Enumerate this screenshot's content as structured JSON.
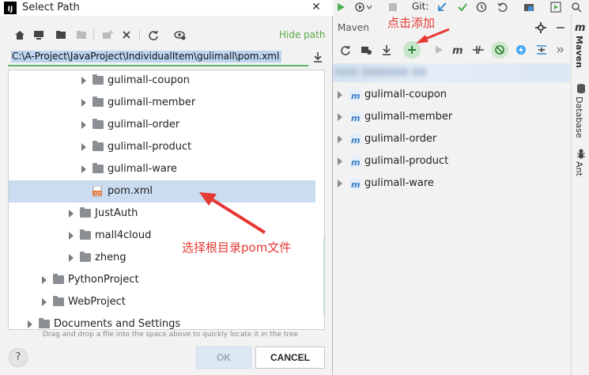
{
  "dialog": {
    "logo_text": "IJ",
    "title": "Select Path",
    "close": "✕",
    "hide_path": "Hide path",
    "path_value": "C:\\A-Project\\JavaProject\\IndividualItem\\gulimall\\pom.xml",
    "tree": [
      {
        "label": "gulimall-coupon",
        "depth": 4,
        "kind": "folder",
        "expandable": true,
        "selected": false
      },
      {
        "label": "gulimall-member",
        "depth": 4,
        "kind": "folder",
        "expandable": true,
        "selected": false
      },
      {
        "label": "gulimall-order",
        "depth": 4,
        "kind": "folder",
        "expandable": true,
        "selected": false
      },
      {
        "label": "gulimall-product",
        "depth": 4,
        "kind": "folder",
        "expandable": true,
        "selected": false
      },
      {
        "label": "gulimall-ware",
        "depth": 4,
        "kind": "folder",
        "expandable": true,
        "selected": false
      },
      {
        "label": "pom.xml",
        "depth": 4,
        "kind": "file",
        "expandable": false,
        "selected": true
      },
      {
        "label": "JustAuth",
        "depth": 3,
        "kind": "folder",
        "expandable": true,
        "selected": false
      },
      {
        "label": "mall4cloud",
        "depth": 3,
        "kind": "folder",
        "expandable": true,
        "selected": false
      },
      {
        "label": "zheng",
        "depth": 3,
        "kind": "folder",
        "expandable": true,
        "selected": false
      },
      {
        "label": "PythonProject",
        "depth": 2,
        "kind": "folder",
        "expandable": true,
        "selected": false
      },
      {
        "label": "WebProject",
        "depth": 2,
        "kind": "folder",
        "expandable": true,
        "selected": false
      },
      {
        "label": "Documents and Settings",
        "depth": 1,
        "kind": "link-folder",
        "expandable": true,
        "selected": false
      }
    ],
    "hint": "Drag and drop a file into the space above to quickly locate it in the tree",
    "help": "?",
    "ok": "OK",
    "cancel": "CANCEL"
  },
  "ide": {
    "git_label": "Git:",
    "maven_title": "Maven",
    "modules": [
      "gulimall-coupon",
      "gulimall-member",
      "gulimall-order",
      "gulimall-product",
      "gulimall-ware"
    ],
    "side_tabs": {
      "maven": "Maven",
      "database": "Database",
      "ant": "Ant"
    }
  },
  "annotations": {
    "top": "点击添加",
    "middle": "选择根目录pom文件"
  },
  "colors": {
    "annotation_red": "#e53935",
    "selection_blue": "#cbdcf1",
    "hide_path_green": "#5aa845",
    "input_underline_green": "#5fb36a"
  }
}
